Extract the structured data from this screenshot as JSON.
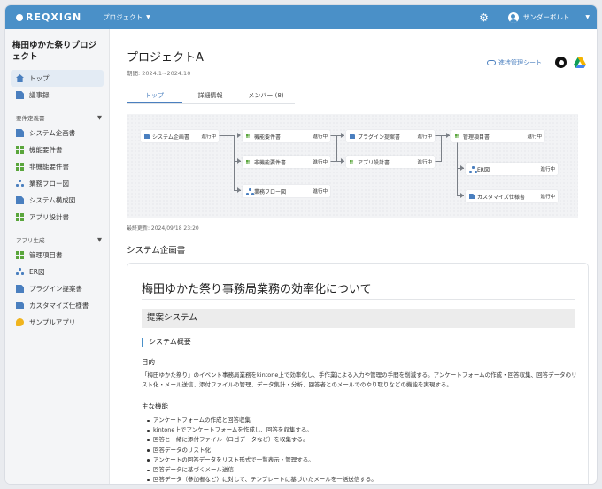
{
  "topbar": {
    "logo": "REQXIGN",
    "project_menu": "プロジェクト",
    "user_name": "サンダーボルト"
  },
  "sidebar": {
    "project_name": "梅田ゆかた祭りプロジェクト",
    "top_items": [
      {
        "label": "トップ",
        "icon": "home-icon",
        "active": true
      },
      {
        "label": "議事録",
        "icon": "document-icon"
      }
    ],
    "sections": [
      {
        "label": "要件定義書",
        "items": [
          {
            "label": "システム企画書",
            "icon": "document-icon"
          },
          {
            "label": "機能要件書",
            "icon": "grid-icon"
          },
          {
            "label": "非機能要件書",
            "icon": "grid-icon"
          },
          {
            "label": "業務フロー図",
            "icon": "flow-icon"
          },
          {
            "label": "システム構成図",
            "icon": "document-icon"
          },
          {
            "label": "アプリ設計書",
            "icon": "grid-icon"
          }
        ]
      },
      {
        "label": "アプリ生成",
        "items": [
          {
            "label": "管理項目書",
            "icon": "grid-icon"
          },
          {
            "label": "ER図",
            "icon": "flow-icon"
          },
          {
            "label": "プラグイン提案書",
            "icon": "document-icon"
          },
          {
            "label": "カスタマイズ仕様書",
            "icon": "document-icon"
          },
          {
            "label": "サンプルアプリ",
            "icon": "bubble-icon"
          }
        ]
      }
    ]
  },
  "main": {
    "title": "プロジェクトA",
    "period": "期間: 2024.1~2024.10",
    "progress_link": "進捗管理シート",
    "tabs": [
      {
        "label": "トップ",
        "active": true
      },
      {
        "label": "詳細情報"
      },
      {
        "label": "メンバー (8)"
      }
    ],
    "diagram": {
      "status": "進行中",
      "nodes": [
        {
          "label": "システム企画書",
          "icon": "document-icon"
        },
        {
          "label": "機能要件書",
          "icon": "grid-icon"
        },
        {
          "label": "非機能要件書",
          "icon": "grid-icon"
        },
        {
          "label": "業務フロー図",
          "icon": "flow-icon"
        },
        {
          "label": "プラグイン提案書",
          "icon": "document-icon"
        },
        {
          "label": "アプリ設計書",
          "icon": "grid-icon"
        },
        {
          "label": "管理項目書",
          "icon": "grid-icon"
        },
        {
          "label": "ER図",
          "icon": "flow-icon"
        },
        {
          "label": "カスタマイズ仕様書",
          "icon": "document-icon"
        }
      ]
    },
    "last_updated": "最終更新: 2024/09/18 23:20",
    "section_title": "システム企画書"
  },
  "doc": {
    "h1": "梅田ゆかた祭り事務局業務の効率化について",
    "h2": "提案システム",
    "h3": "システム概要",
    "purpose_heading": "目的",
    "purpose_text": "「梅田ゆかた祭り」のイベント事務局業務をkintone上で効率化し、手作業による入力や管理の手間を削減する。アンケートフォームの作成・回答収集、回答データのリスト化・メール送信、添付ファイルの管理、データ集計・分析、回答者とのメールでのやり取りなどの機能を実現する。",
    "features_heading": "主な機能",
    "features": [
      "アンケートフォームの作成と回答収集",
      "kintone上でアンケートフォームを作成し、回答を収集する。",
      "回答と一緒に添付ファイル（ロゴデータなど）を収集する。",
      "回答データのリスト化",
      "アンケートの回答データをリスト形式で一覧表示・管理する。",
      "回答データに基づくメール送信",
      "回答データ（参加者など）に対して、テンプレートに基づいたメールを一括送信する。"
    ]
  },
  "colors": {
    "topbar": "#4a90c8",
    "accent": "#4a7fbf",
    "grid_icon": "#5aa63c"
  }
}
